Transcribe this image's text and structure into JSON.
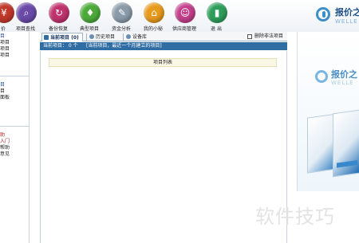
{
  "toolbar": {
    "items": [
      {
        "label": "价",
        "icon": "price-icon",
        "color": "#c0392b",
        "glyph": "¥"
      },
      {
        "label": "项目查找",
        "icon": "search-icon",
        "color": "#6b4aa8",
        "glyph": "⌕"
      },
      {
        "label": "备份恢复",
        "icon": "backup-icon",
        "color": "#c0326e",
        "glyph": "↻"
      },
      {
        "label": "典型项目",
        "icon": "stamp-icon",
        "color": "#4caa3a",
        "glyph": "♦"
      },
      {
        "label": "资金分析",
        "icon": "analysis-icon",
        "color": "#8a9aa8",
        "glyph": "✎"
      },
      {
        "label": "我的小秘",
        "icon": "home-icon",
        "color": "#e79a1c",
        "glyph": "⌂"
      },
      {
        "label": "供应商管理",
        "icon": "supplier-icon",
        "color": "#c33f8c",
        "glyph": "☺"
      },
      {
        "label": "退  出",
        "icon": "exit-icon",
        "color": "#2e9e5b",
        "glyph": "▮"
      }
    ]
  },
  "logo": {
    "cn": "报价之",
    "en": "WELLE"
  },
  "sidebar": {
    "items": [
      {
        "label": "目",
        "color": "#2a4fa0"
      },
      {
        "label": "项目",
        "color": "#222222"
      },
      {
        "label": "项目",
        "color": "#222222"
      },
      {
        "label": "项目",
        "color": "#222222"
      },
      {
        "label": "目",
        "color": "#2a4fa0"
      },
      {
        "label": "目",
        "color": "#222222"
      },
      {
        "label": "面板",
        "color": "#222222"
      },
      {
        "label": "助",
        "color": "#b02020"
      },
      {
        "label": "入门",
        "color": "#b02020"
      },
      {
        "label": "帮助",
        "color": "#222222"
      },
      {
        "label": "意见",
        "color": "#222222"
      }
    ]
  },
  "tabs": [
    {
      "label": "当前项目 (0)",
      "active": true,
      "icon": "folder-icon",
      "color": "#2f6da3"
    },
    {
      "label": "历史项目",
      "active": false,
      "icon": "history-icon",
      "color": "#6a8fb5"
    },
    {
      "label": "设备库",
      "active": false,
      "icon": "device-icon",
      "color": "#6a8fb5"
    }
  ],
  "checkbox": {
    "label": "删除非法项目",
    "checked": false
  },
  "status": {
    "count_text": "当前项目： 0 个",
    "hint_text": "[当前项目，最近一个月建立的项目]"
  },
  "list": {
    "header": "项目列表"
  },
  "ad": {
    "cn": "报价之",
    "en": "WELLE"
  },
  "watermark": "软件技巧"
}
